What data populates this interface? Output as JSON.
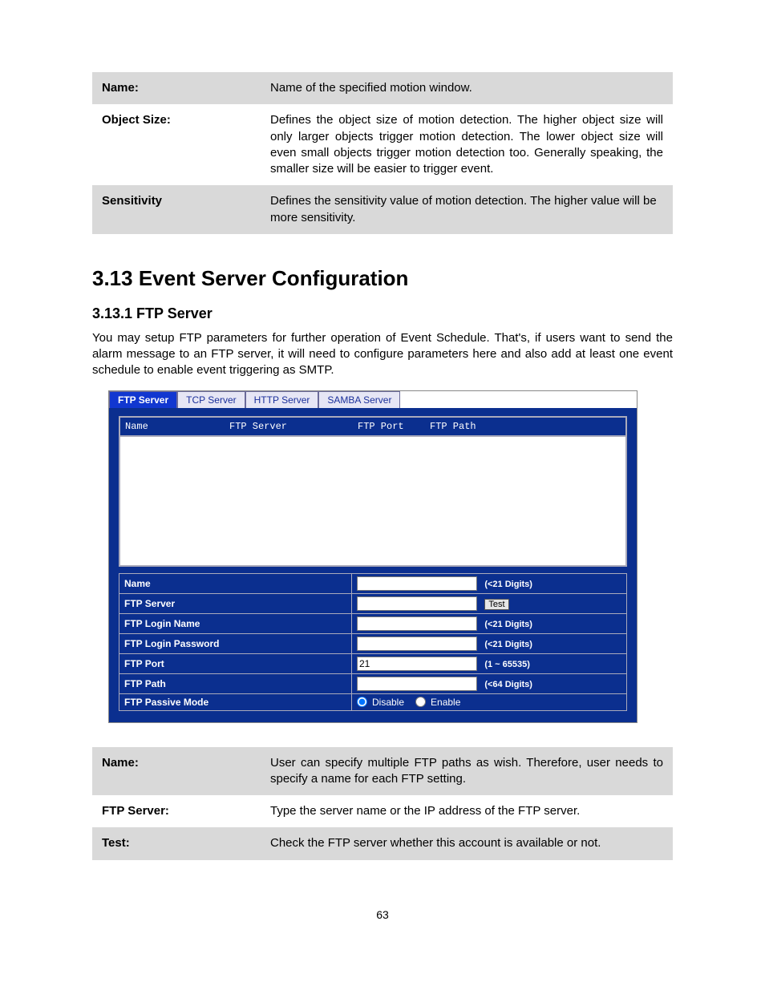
{
  "topTable": {
    "rows": [
      {
        "label": "Name:",
        "value": "Name of the specified motion window.",
        "shaded": true
      },
      {
        "label": "Object Size:",
        "value": "Defines the object size of motion detection. The higher object size will only larger objects trigger motion detection. The lower object size will even small objects trigger motion detection too. Generally speaking, the smaller size will be easier to trigger event.",
        "shaded": false
      },
      {
        "label": "Sensitivity",
        "value": "Defines the sensitivity value of motion detection. The higher value will be more sensitivity.",
        "shaded": true
      }
    ]
  },
  "sectionHeading": "3.13 Event Server Configuration",
  "subsectionHeading": "3.13.1 FTP Server",
  "paragraph": "You may setup FTP parameters for further operation of Event Schedule. That's, if users want to send the alarm message to an FTP server, it will need to configure parameters here and also add at least one event schedule to enable event triggering as SMTP.",
  "tabs": [
    {
      "label": "FTP Server",
      "active": true
    },
    {
      "label": "TCP Server",
      "active": false
    },
    {
      "label": "HTTP Server",
      "active": false
    },
    {
      "label": "SAMBA Server",
      "active": false
    }
  ],
  "listColumns": [
    "Name",
    "FTP Server",
    "FTP Port",
    "FTP Path"
  ],
  "form": {
    "rows": [
      {
        "label": "Name",
        "value": "",
        "hint": "(<21 Digits)",
        "button": null
      },
      {
        "label": "FTP Server",
        "value": "",
        "hint": "",
        "button": "Test"
      },
      {
        "label": "FTP Login Name",
        "value": "",
        "hint": "(<21 Digits)",
        "button": null
      },
      {
        "label": "FTP Login Password",
        "value": "",
        "hint": "(<21 Digits)",
        "button": null
      },
      {
        "label": "FTP Port",
        "value": "21",
        "hint": "(1 ~ 65535)",
        "button": null
      },
      {
        "label": "FTP Path",
        "value": "",
        "hint": "(<64 Digits)",
        "button": null
      }
    ],
    "passiveMode": {
      "label": "FTP Passive Mode",
      "options": [
        "Disable",
        "Enable"
      ],
      "selected": "Disable"
    }
  },
  "bottomTable": {
    "rows": [
      {
        "label": "Name:",
        "value": "User can specify multiple FTP paths as wish. Therefore, user needs to specify a name for each FTP setting.",
        "shaded": true
      },
      {
        "label": "FTP Server:",
        "value": "Type the server name or the IP address of the FTP server.",
        "shaded": false
      },
      {
        "label": "Test:",
        "value": "Check the FTP server whether this account is available or not.",
        "shaded": true
      }
    ]
  },
  "pageNumber": "63"
}
